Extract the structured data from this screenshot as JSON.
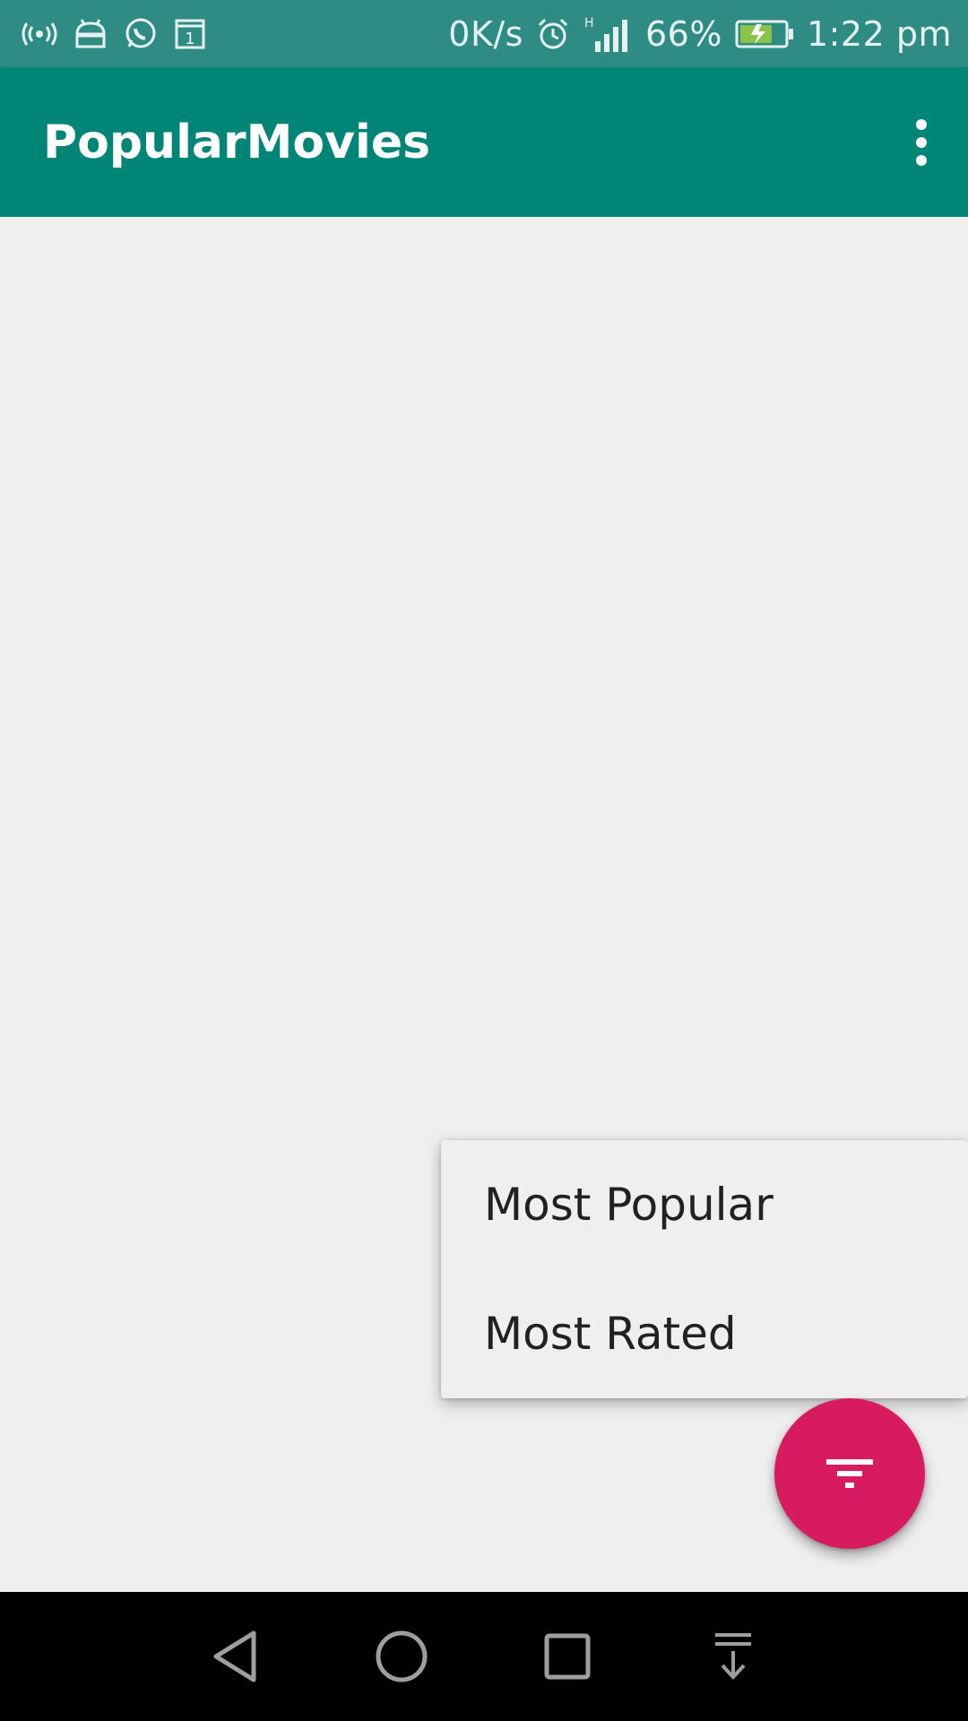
{
  "status_bar": {
    "network_speed": "0K/s",
    "network_type": "H",
    "battery_percent": "66%",
    "time": "1:22 pm",
    "icons": [
      "hotspot-icon",
      "android-icon",
      "whatsapp-icon",
      "calendar-icon",
      "alarm-icon",
      "signal-icon",
      "battery-charging-icon"
    ],
    "calendar_day": "1"
  },
  "app_bar": {
    "title": "PopularMovies",
    "overflow_icon": "more-vert-icon"
  },
  "popup_menu": {
    "items": [
      {
        "label": "Most Popular"
      },
      {
        "label": "Most Rated"
      }
    ]
  },
  "fab": {
    "icon": "filter-icon",
    "color": "#D81B60"
  },
  "nav_bar": {
    "buttons": [
      "back-icon",
      "home-icon",
      "recents-icon",
      "notification-pull-icon"
    ]
  },
  "colors": {
    "status_bar": "#2E8C85",
    "primary": "#008577",
    "accent": "#D81B60",
    "background": "#EFEFEF"
  }
}
